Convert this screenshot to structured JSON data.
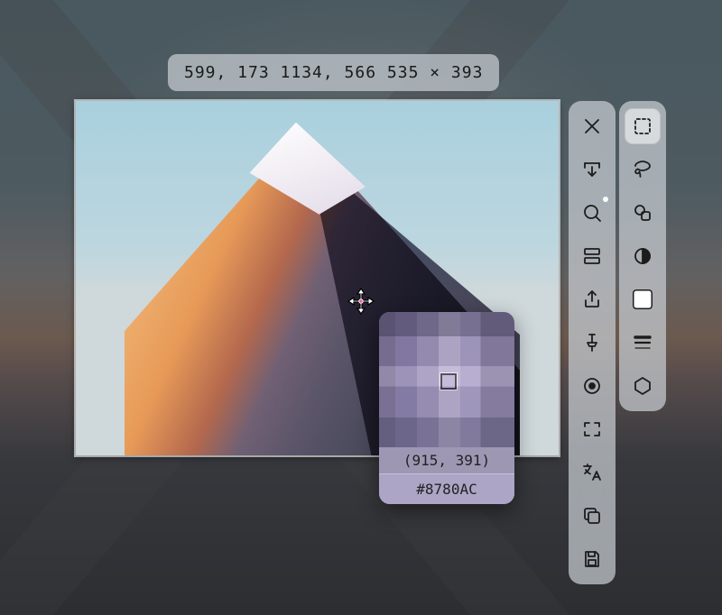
{
  "info_pill": "599, 173  1134, 566  535 × 393",
  "magnifier": {
    "coord_text": "(915, 391)",
    "color_hex": "#8780AC"
  },
  "left_toolbar": [
    {
      "name": "close",
      "label": "Close"
    },
    {
      "name": "scroll-capture",
      "label": "Scrolling capture"
    },
    {
      "name": "search",
      "label": "Search / OCR"
    },
    {
      "name": "split",
      "label": "Split view"
    },
    {
      "name": "share",
      "label": "Share / Export"
    },
    {
      "name": "pin",
      "label": "Pin"
    },
    {
      "name": "record",
      "label": "Record"
    },
    {
      "name": "fullscreen",
      "label": "Fullscreen"
    },
    {
      "name": "translate",
      "label": "Translate"
    },
    {
      "name": "copy",
      "label": "Copy"
    },
    {
      "name": "save",
      "label": "Save"
    }
  ],
  "right_toolbar": [
    {
      "name": "marquee",
      "label": "Rectangle select",
      "active": true
    },
    {
      "name": "lasso",
      "label": "Freehand"
    },
    {
      "name": "shapes",
      "label": "Shapes"
    },
    {
      "name": "contrast",
      "label": "Half-circle tool"
    },
    {
      "name": "fill",
      "label": "Fill color"
    },
    {
      "name": "align",
      "label": "Line style"
    },
    {
      "name": "hexagon",
      "label": "Polygon"
    }
  ]
}
